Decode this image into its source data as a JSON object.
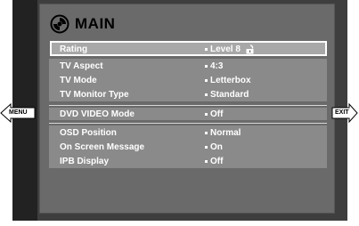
{
  "title": "MAIN",
  "items": [
    {
      "label": "Rating",
      "value": "Level  8"
    },
    {
      "label": "TV Aspect",
      "value": "4:3"
    },
    {
      "label": "TV Mode",
      "value": "Letterbox"
    },
    {
      "label": "TV Monitor Type",
      "value": "Standard"
    },
    {
      "label": "DVD VIDEO Mode",
      "value": "Off"
    },
    {
      "label": "OSD  Position",
      "value": "Normal"
    },
    {
      "label": "On Screen Message",
      "value": "On"
    },
    {
      "label": "IPB Display",
      "value": "Off"
    }
  ],
  "nav": {
    "left": "MENU",
    "right": "EXIT"
  },
  "icons": {
    "title": "disc-icon",
    "rating": "padlock-open-icon"
  },
  "colors": {
    "panel": "#6a6a6a",
    "block": "#8a8a8a",
    "selected": "#a8a8a8",
    "frame": "#3e3e3e"
  }
}
